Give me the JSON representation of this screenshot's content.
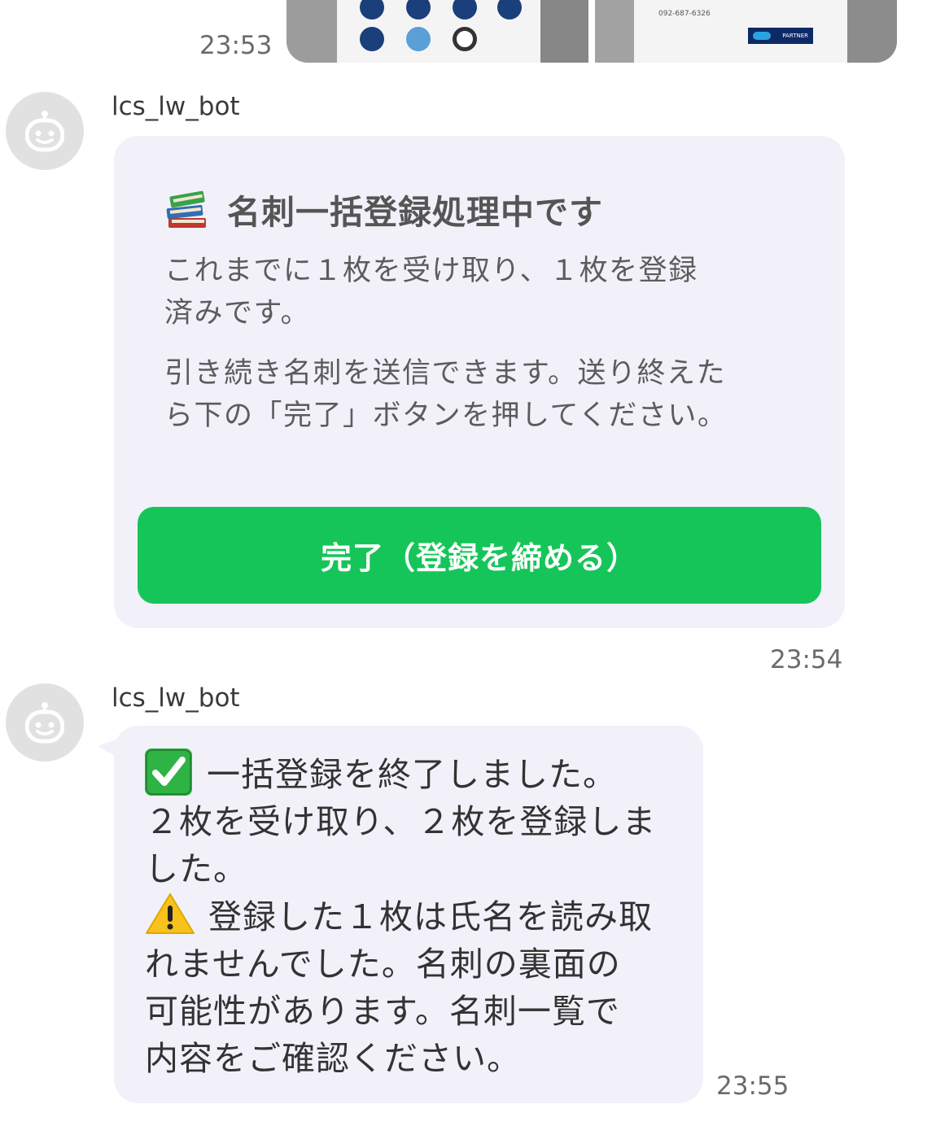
{
  "sent_images": {
    "time": "23:53",
    "photo_1_icon_names": [
      "certification-badge-icon",
      "certification-badge-icon",
      "certification-badge-icon",
      "certification-badge-icon",
      "certification-badge-icon",
      "certification-badge-icon",
      "copyright-icon"
    ],
    "photo_2_phone": "092-687-6326",
    "photo_2_badge": "PARTNER"
  },
  "messages": [
    {
      "sender": "lcs_lw_bot",
      "avatar_icon": "bot-face-icon",
      "card": {
        "title_icon": "books-emoji-icon",
        "title": "名刺一括登録処理中です",
        "paragraph_1_line_1": "これまでに１枚を受け取り、１枚を登録",
        "paragraph_1_line_2": "済みです。",
        "paragraph_2_line_1": "引き続き名刺を送信できます。送り終えた",
        "paragraph_2_line_2": "ら下の「完了」ボタンを押してください。",
        "button_label": "完了（登録を締める）",
        "button_color": "#16c559"
      },
      "time": "23:54"
    },
    {
      "sender": "lcs_lw_bot",
      "avatar_icon": "bot-face-icon",
      "lines": [
        "一括登録を終了しました。",
        "２枚を受け取り、２枚を登録しま",
        "した。",
        "登録した１枚は氏名を読み取",
        "れませんでした。名刺の裏面の",
        "可能性があります。名刺一覧で",
        "内容をご確認ください。"
      ],
      "line_1_icon": "check-mark-emoji-icon",
      "line_4_icon": "warning-emoji-icon",
      "time": "23:55"
    }
  ],
  "colors": {
    "bubble_background": "#f2f1fa",
    "timestamp": "#6b6b6b"
  }
}
